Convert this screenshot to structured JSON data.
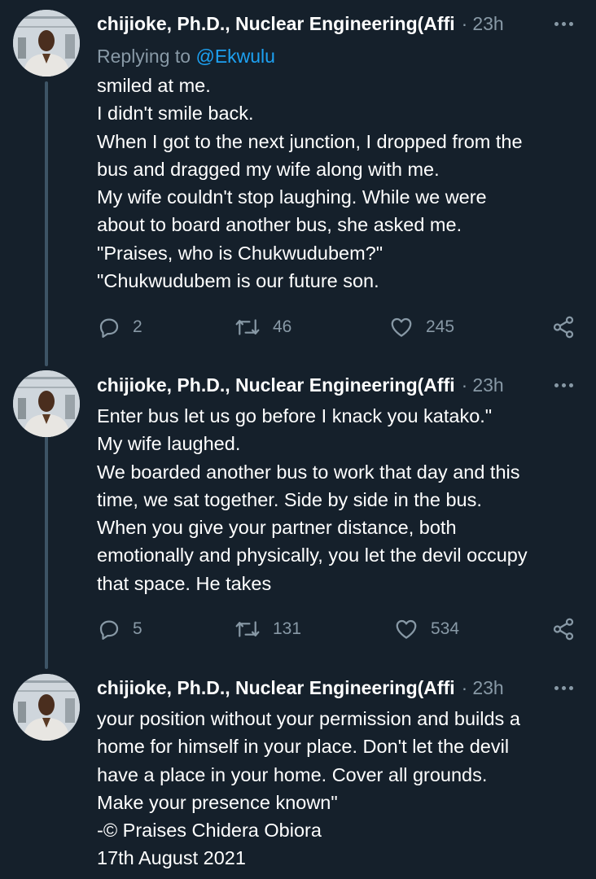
{
  "tweets": [
    {
      "author": "chijioke, Ph.D., Nuclear Engineering(Affi",
      "separator": "·",
      "time": "23h",
      "replying_prefix": "Replying to",
      "replying_handle": "@Ekwulu",
      "lines": [
        "smiled at me.",
        "I didn't smile back.",
        "When I got to the next junction, I dropped from the",
        "bus and dragged my wife along with me.",
        "My wife couldn't stop laughing. While we were",
        "about to board another bus, she asked me.",
        "\"Praises, who is Chukwudubem?\"",
        "\"Chukwudubem is our future son."
      ],
      "replies": "2",
      "retweets": "46",
      "likes": "245"
    },
    {
      "author": "chijioke, Ph.D., Nuclear Engineering(Affi",
      "separator": "·",
      "time": "23h",
      "lines": [
        "Enter bus let us go before I knack you katako.\"",
        "My wife laughed.",
        "We boarded another bus to work that day and this",
        "time, we sat together. Side by side in the bus.",
        "When you give your partner distance, both",
        "emotionally and physically, you let the devil occupy",
        "that space. He takes"
      ],
      "replies": "5",
      "retweets": "131",
      "likes": "534"
    },
    {
      "author": "chijioke, Ph.D., Nuclear Engineering(Affi",
      "separator": "·",
      "time": "23h",
      "lines": [
        "your position without your permission and builds a",
        "home for himself in your place. Don't let the devil",
        "have a place in your home. Cover all grounds.",
        "Make your presence known\"",
        "-© Praises Chidera Obiora",
        "17th August 2021"
      ]
    }
  ],
  "icons": {
    "reply": "reply-icon",
    "retweet": "retweet-icon",
    "like": "heart-icon",
    "share": "share-icon",
    "more": "more-icon"
  },
  "colors": {
    "background": "#15202b",
    "text": "#ffffff",
    "secondary": "#8899a6",
    "link": "#1da1f2",
    "thread_line": "#3d5466"
  }
}
